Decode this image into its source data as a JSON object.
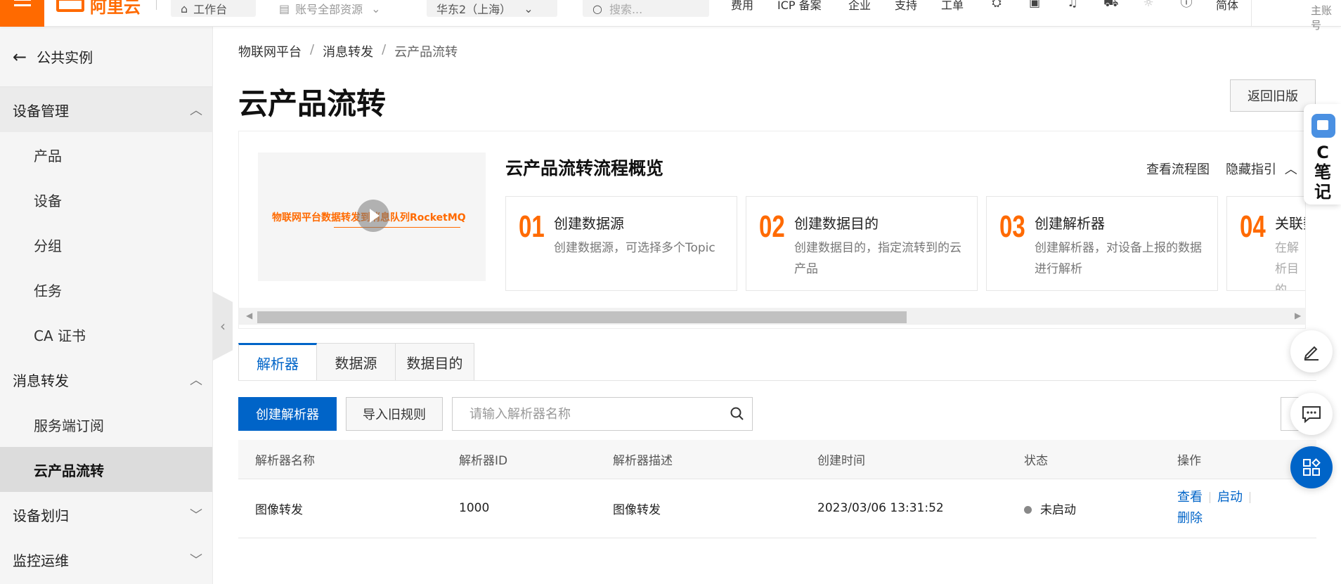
{
  "topbar": {
    "logo": "阿里云",
    "workbench": "工作台",
    "resource": "账号全部资源",
    "region": "华东2（上海）",
    "search_placeholder": "搜索...",
    "links": [
      "费用",
      "ICP 备案",
      "企业",
      "支持",
      "工单"
    ],
    "language": "简体",
    "account": "主账号"
  },
  "sidebar": {
    "back_label": "公共实例",
    "groups": [
      {
        "label": "设备管理",
        "expanded": true,
        "items": [
          "产品",
          "设备",
          "分组",
          "任务",
          "CA 证书"
        ]
      },
      {
        "label": "消息转发",
        "expanded": true,
        "items": [
          "服务端订阅",
          "云产品流转"
        ]
      },
      {
        "label": "设备划归",
        "expanded": false,
        "items": []
      },
      {
        "label": "监控运维",
        "expanded": false,
        "items": []
      }
    ],
    "active_item": "云产品流转"
  },
  "breadcrumb": [
    "物联网平台",
    "消息转发",
    "云产品流转"
  ],
  "page_title": "云产品流转",
  "old_version_button": "返回旧版",
  "guide": {
    "video_caption": "物联网平台数据转发到消息队列RocketMQ",
    "title": "云产品流转流程概览",
    "view_flow_link": "查看流程图",
    "hide_guide_link": "隐藏指引",
    "steps": [
      {
        "num": "01",
        "title": "创建数据源",
        "desc": "创建数据源，可选择多个Topic"
      },
      {
        "num": "02",
        "title": "创建数据目的",
        "desc": "创建数据目的，指定流转到的云产品"
      },
      {
        "num": "03",
        "title": "创建解析器",
        "desc": "创建解析器，对设备上报的数据进行解析"
      },
      {
        "num": "04",
        "title": "关联数",
        "desc": "在解析目的"
      }
    ]
  },
  "tabs": [
    "解析器",
    "数据源",
    "数据目的"
  ],
  "active_tab": "解析器",
  "toolbar": {
    "create_button": "创建解析器",
    "import_button": "导入旧规则",
    "search_placeholder": "请输入解析器名称"
  },
  "table": {
    "columns": [
      "解析器名称",
      "解析器ID",
      "解析器描述",
      "创建时间",
      "状态",
      "操作"
    ],
    "rows": [
      {
        "name": "图像转发",
        "id": "1000",
        "desc": "图像转发",
        "created": "2023/03/06 13:31:52",
        "status": "未启动",
        "actions": [
          "查看",
          "启动",
          "删除"
        ]
      }
    ]
  },
  "notes_widget": {
    "label_top": "C",
    "label": "笔记"
  },
  "colors": {
    "brand": "#ff6a00",
    "primary": "#0064c8",
    "status_inactive": "#888888"
  }
}
